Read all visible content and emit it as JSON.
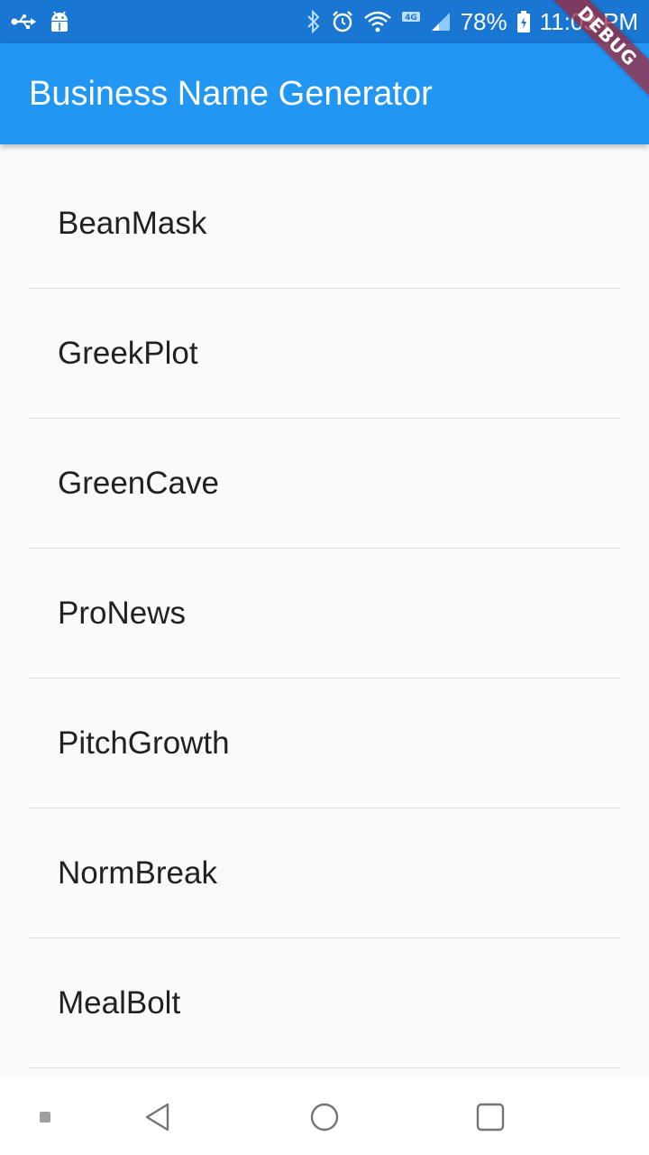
{
  "status_bar": {
    "battery_percent": "78%",
    "time": "11:03 PM",
    "network_label": "4G",
    "icons": [
      "usb-icon",
      "android-debug-icon",
      "bluetooth-icon",
      "alarm-icon",
      "wifi-icon",
      "signal-icon",
      "battery-icon"
    ]
  },
  "app_bar": {
    "title": "Business Name Generator"
  },
  "debug_banner": {
    "label": "DEBUG"
  },
  "list": {
    "items": [
      {
        "label": "BeanMask"
      },
      {
        "label": "GreekPlot"
      },
      {
        "label": "GreenCave"
      },
      {
        "label": "ProNews"
      },
      {
        "label": "PitchGrowth"
      },
      {
        "label": "NormBreak"
      },
      {
        "label": "MealBolt"
      }
    ]
  },
  "nav_bar": {
    "icons": [
      "dot-icon",
      "back-icon",
      "home-icon",
      "recents-icon"
    ]
  },
  "colors": {
    "status_bar": "#1976d2",
    "app_bar": "#2196f3",
    "background": "#fafafa",
    "divider": "#e0e0e0",
    "text_primary": "#212121",
    "debug_banner": "#a0283c"
  }
}
